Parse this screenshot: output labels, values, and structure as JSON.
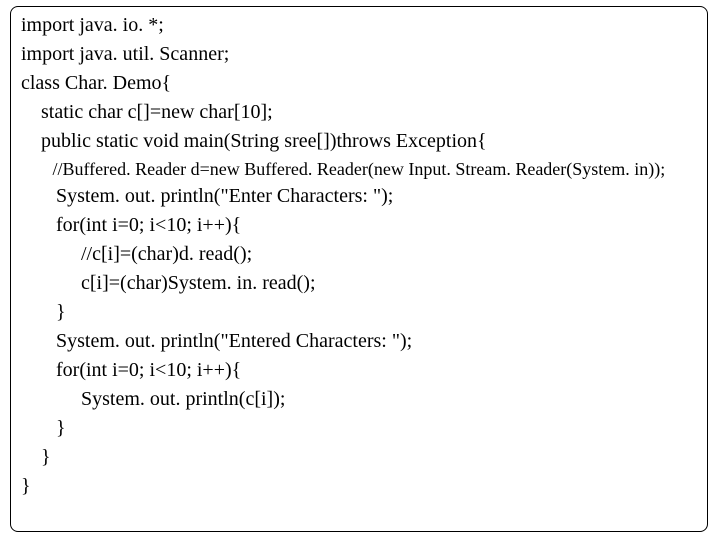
{
  "code": {
    "l1": "import java. io. *;",
    "l2": "import java. util. Scanner;",
    "l3": "class Char. Demo{",
    "l4": "    static char c[]=new char[10];",
    "l5": "    public static void main(String sree[])throws Exception{",
    "l6": "       //Buffered. Reader d=new Buffered. Reader(new Input. Stream. Reader(System. in));",
    "l7": "       System. out. println(\"Enter Characters: \");",
    "l8": "       for(int i=0; i<10; i++){",
    "l9": "            //c[i]=(char)d. read();",
    "l10": "            c[i]=(char)System. in. read();",
    "l11": "       }",
    "l12": "       System. out. println(\"Entered Characters: \");",
    "l13": "       for(int i=0; i<10; i++){",
    "l14": "            System. out. println(c[i]);",
    "l15": "       }",
    "l16": "    }",
    "l17": "}"
  }
}
